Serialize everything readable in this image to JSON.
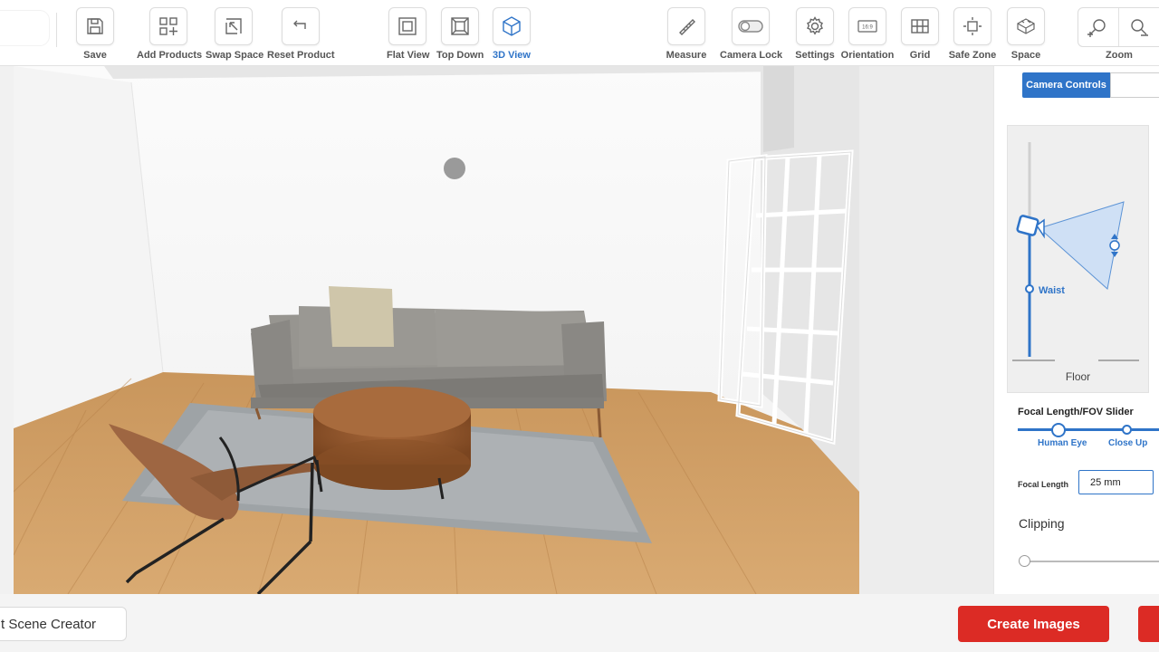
{
  "toolbar": {
    "save": "Save",
    "add_products": "Add Products",
    "swap_space": "Swap Space",
    "reset_product": "Reset Product",
    "flat_view": "Flat View",
    "top_down": "Top Down",
    "view_3d": "3D View",
    "measure": "Measure",
    "camera_lock": "Camera Lock",
    "settings": "Settings",
    "orientation": "Orientation",
    "orientation_badge": "16:9",
    "grid": "Grid",
    "safe_zone": "Safe Zone",
    "space": "Space",
    "zoom": "Zoom",
    "active_view": "3D View",
    "camera_lock_enabled": false
  },
  "panel": {
    "tab_active": "Camera Controls",
    "camera_height": {
      "floor_label": "Floor",
      "waist_label": "Waist",
      "level": 0.35
    },
    "fov": {
      "title": "Focal Length/FOV Slider",
      "left_label": "Human Eye",
      "right_label": "Close Up",
      "value": 0.3
    },
    "focal_length": {
      "label": "Focal Length",
      "value": "25 mm"
    },
    "clipping": {
      "label": "Clipping",
      "value": 0
    }
  },
  "bottom": {
    "exit_label": "t Scene Creator",
    "create_label": "Create Images"
  },
  "colors": {
    "accent": "#2f74c8",
    "primary_action": "#dc2b25"
  }
}
